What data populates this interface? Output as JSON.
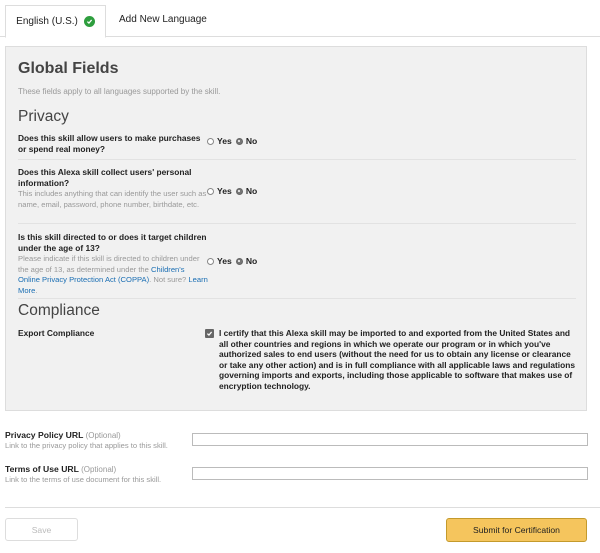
{
  "tabs": {
    "active": "English (U.S.)",
    "add": "Add New Language"
  },
  "global": {
    "title": "Global Fields",
    "subtitle": "These fields apply to all languages supported by the skill."
  },
  "privacy": {
    "title": "Privacy",
    "q1": {
      "question": "Does this skill allow users to make purchases or spend real money?",
      "yes": "Yes",
      "no": "No",
      "selected": "No"
    },
    "q2": {
      "question": "Does this Alexa skill collect users' personal information?",
      "help": "This includes anything that can identify the user such as name, email, password, phone number, birthdate, etc.",
      "yes": "Yes",
      "no": "No",
      "selected": "No"
    },
    "q3": {
      "question": "Is this skill directed to or does it target children under the age of 13?",
      "help_pre": "Please indicate if this skill is directed to children under the age of 13, as determined under the",
      "help_link": "Children's Online Privacy Protection Act (COPPA)",
      "help_post": ".",
      "not_sure": "Not sure?",
      "learn_more": "Learn More",
      "period": ".",
      "yes": "Yes",
      "no": "No",
      "selected": "No"
    }
  },
  "compliance": {
    "title": "Compliance",
    "export_label": "Export Compliance",
    "cert_text": "I certify that this Alexa skill may be imported to and exported from the United States and all other countries and regions in which we operate our program or in which you've authorized sales to end users (without the need for us to obtain any license or clearance or take any other action) and is in full compliance with all applicable laws and regulations governing imports and exports, including those applicable to software that makes use of encryption technology.",
    "checked": true
  },
  "privacy_url": {
    "label": "Privacy Policy URL",
    "optional": "(Optional)",
    "help": "Link to the privacy policy that applies to this skill.",
    "value": ""
  },
  "terms_url": {
    "label": "Terms of Use URL",
    "optional": "(Optional)",
    "help": "Link to the terms of use document for this skill.",
    "value": ""
  },
  "actions": {
    "save": "Save",
    "submit": "Submit for Certification"
  },
  "colors": {
    "accent_green": "#2e9e3e",
    "submit_bg": "#f5c55d",
    "link": "#1a6eb3"
  }
}
